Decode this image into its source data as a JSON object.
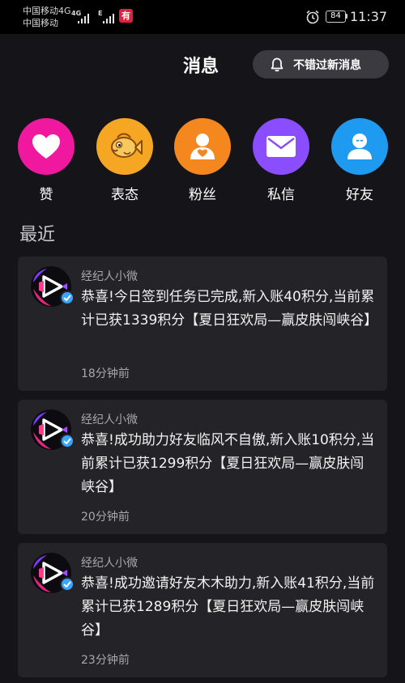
{
  "status_bar": {
    "carrier1": "中国移动",
    "carrier1_net": "4G",
    "carrier2": "中国移动",
    "carrier2_net": "E",
    "app_badge": "有",
    "battery": "84",
    "time": "11:37"
  },
  "header": {
    "title": "消息",
    "subscribe_label": "不错过新消息"
  },
  "categories": [
    {
      "label": "赞",
      "color": "#f0189e",
      "icon": "heart-icon"
    },
    {
      "label": "表态",
      "color": "#f5a623",
      "icon": "fish-icon"
    },
    {
      "label": "粉丝",
      "color": "#f5871f",
      "icon": "user-heart-icon"
    },
    {
      "label": "私信",
      "color": "#8a4dff",
      "icon": "mail-icon"
    },
    {
      "label": "好友",
      "color": "#1e9bf0",
      "icon": "friend-icon"
    }
  ],
  "recent_title": "最近",
  "messages": [
    {
      "sender": "经纪人小微",
      "text": "恭喜!今日签到任务已完成,新入账40积分,当前累计已获1339积分【夏日狂欢局—赢皮肤闯峡谷】",
      "time": "18分钟前"
    },
    {
      "sender": "经纪人小微",
      "text": "恭喜!成功助力好友临风不自傲,新入账10积分,当前累计已获1299积分【夏日狂欢局—赢皮肤闯峡谷】",
      "time": "20分钟前"
    },
    {
      "sender": "经纪人小微",
      "text": "恭喜!成功邀请好友木木助力,新入账41积分,当前累计已获1289积分【夏日狂欢局—赢皮肤闯峡谷】",
      "time": "23分钟前"
    }
  ]
}
